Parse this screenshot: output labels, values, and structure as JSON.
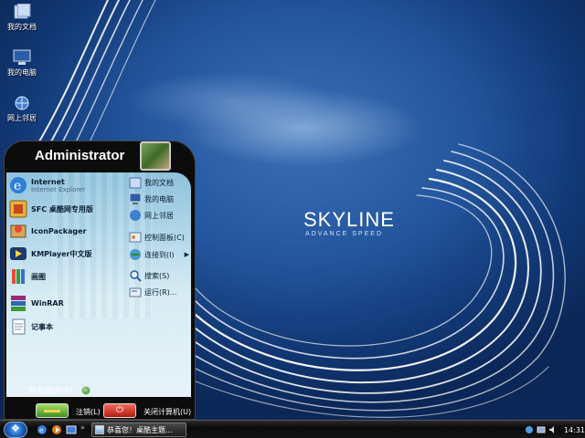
{
  "desktop": {
    "icons": [
      {
        "label": "我的文档",
        "icon": "documents-folder-icon"
      },
      {
        "label": "我的电脑",
        "icon": "computer-icon"
      },
      {
        "label": "网上邻居",
        "icon": "network-icon"
      }
    ],
    "logo": {
      "title": "SKYLINE",
      "subtitle": "ADVANCE SPEED"
    }
  },
  "start_menu": {
    "user_name": "Administrator",
    "left_items": [
      {
        "title": "Internet",
        "subtitle": "Internet Explorer",
        "icon": "internet-explorer-icon"
      },
      {
        "title": "SFC 桌酷网专用版",
        "icon": "sfc-app-icon"
      },
      {
        "title": "IconPackager",
        "icon": "iconpackager-icon"
      },
      {
        "title": "KMPlayer中文版",
        "icon": "kmplayer-icon"
      },
      {
        "title": "画图",
        "icon": "paint-icon"
      },
      {
        "title": "WinRAR",
        "icon": "winrar-icon"
      },
      {
        "title": "记事本",
        "icon": "notepad-icon"
      }
    ],
    "right_items": [
      {
        "label": "我的文档",
        "icon": "documents-folder-icon"
      },
      {
        "label": "我的电脑",
        "icon": "computer-icon"
      },
      {
        "label": "网上邻居",
        "icon": "network-icon"
      },
      {
        "label": "控制面板(C)",
        "icon": "control-panel-icon"
      },
      {
        "label": "连接到(I)",
        "icon": "connect-to-icon",
        "has_submenu": true
      },
      {
        "label": "搜索(S)",
        "icon": "search-icon"
      },
      {
        "label": "运行(R)...",
        "icon": "run-icon"
      }
    ],
    "all_programs": "所有程序(P)",
    "logoff_label": "注销(L)",
    "shutdown_label": "关闭计算机(U)"
  },
  "taskbar": {
    "task_label": "恭喜您！桌酷主题...",
    "clock": "14:31"
  },
  "colors": {
    "desktop_blue": "#24569e",
    "menu_dark": "#0c0c0c",
    "menu_body": "#b5d9ea",
    "logoff_green": "#3f8c1f",
    "shutdown_red": "#b51a12"
  }
}
